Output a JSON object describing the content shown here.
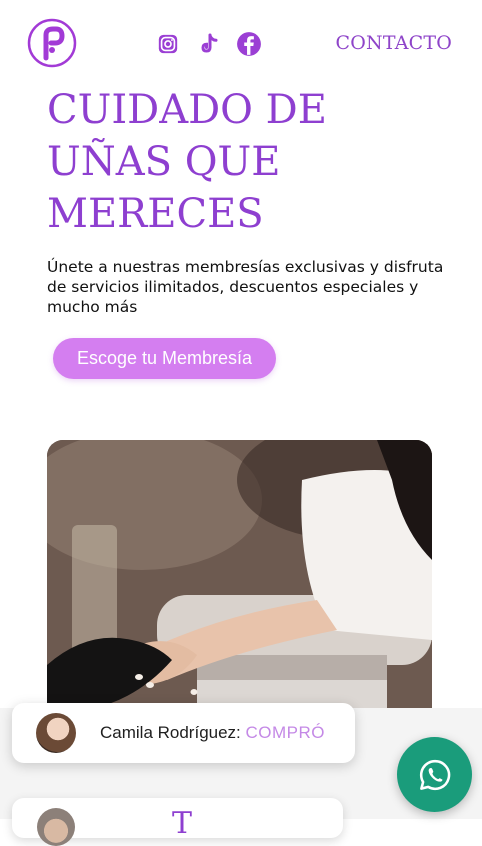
{
  "header": {
    "contact_label": "CONTACTO",
    "social_icons": [
      "instagram-icon",
      "tiktok-icon",
      "facebook-icon"
    ],
    "logo_icon": "brand-logo-p"
  },
  "hero": {
    "title_lines": [
      "CUIDADO DE",
      "UÑAS QUE",
      "MERECES"
    ],
    "description": "Únete a nuestras membresías exclusivas y disfruta de servicios ilimitados, descuentos especiales y mucho más",
    "cta_label": "Escoge tu Membresía"
  },
  "notification": {
    "name": "Camila Rodríguez:",
    "status": "COMPRÓ"
  },
  "notification_2": {
    "peek_text": "T"
  },
  "colors": {
    "brand_purple": "#8e3fd0",
    "cta_pink": "#d47ef0",
    "status_text": "#c489e6",
    "whatsapp_green": "#1a9c7b"
  },
  "whatsapp_button_icon": "whatsapp-icon"
}
